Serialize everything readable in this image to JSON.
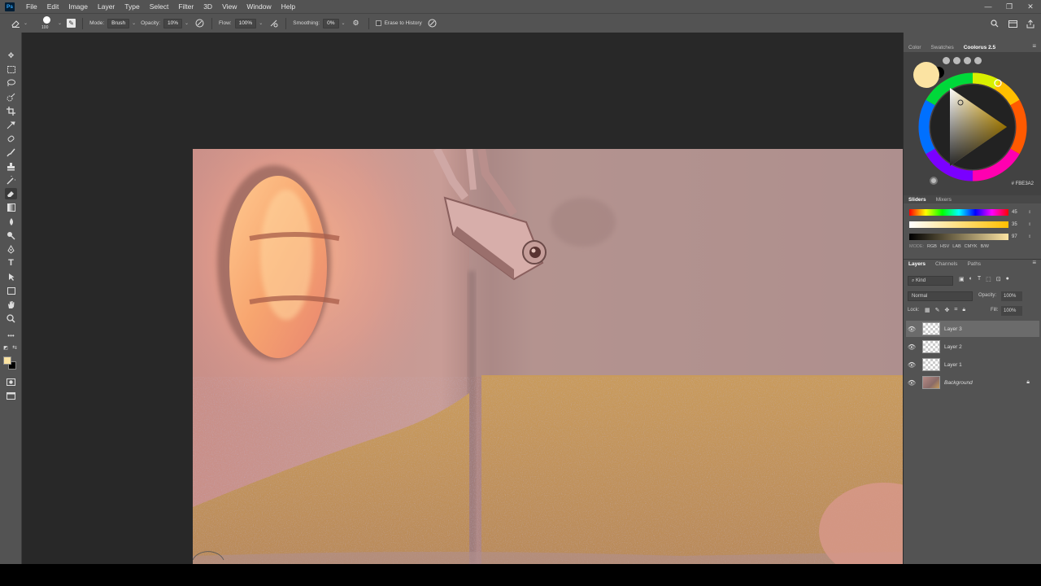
{
  "app": {
    "logo_text": "Ps"
  },
  "menu": [
    "File",
    "Edit",
    "Image",
    "Layer",
    "Type",
    "Select",
    "Filter",
    "3D",
    "View",
    "Window",
    "Help"
  ],
  "window_controls": [
    "—",
    "❐",
    "✕"
  ],
  "options": {
    "brush_size": "100",
    "mode_label": "Mode:",
    "mode_value": "Brush",
    "opacity_label": "Opacity:",
    "opacity_value": "10%",
    "flow_label": "Flow:",
    "flow_value": "100%",
    "smoothing_label": "Smoothing:",
    "smoothing_value": "0%",
    "erase_history_label": "Erase to History"
  },
  "color_panel": {
    "tabs": [
      "Color",
      "Swatches",
      "Coolorus 2.5"
    ],
    "active_tab": "Coolorus 2.5",
    "foreground_color": "#fbe3a2",
    "hex_value": "# FBE3A2",
    "slider_tabs": [
      "Sliders",
      "Mixers"
    ],
    "active_slider_tab": "Sliders",
    "h_value": "45",
    "s_value": "35",
    "b_value": "97",
    "mode_label": "MODE:",
    "modes": [
      "RGB",
      "HSV",
      "LAB",
      "CMYK",
      "B/W"
    ]
  },
  "layers_panel": {
    "tabs": [
      "Layers",
      "Channels",
      "Paths"
    ],
    "active_tab": "Layers",
    "kind_label": "Kind",
    "blend_mode": "Normal",
    "opacity_label": "Opacity:",
    "opacity_value": "100%",
    "lock_label": "Lock:",
    "fill_label": "Fill:",
    "fill_value": "100%",
    "layers": [
      {
        "name": "Layer 3",
        "selected": true
      },
      {
        "name": "Layer 2",
        "selected": false
      },
      {
        "name": "Layer 1",
        "selected": false
      },
      {
        "name": "Background",
        "selected": false,
        "locked": true
      }
    ]
  },
  "colors": {
    "menubar": "#535353",
    "workspace": "#282828",
    "accent": "#31a8ff"
  },
  "icons": [
    "eraser-icon",
    "brush-settings-icon",
    "airbrush-icon",
    "pressure-icon",
    "gear-icon",
    "search-icon",
    "workspace-icon",
    "share-icon",
    "eye-icon",
    "lock-icon"
  ]
}
